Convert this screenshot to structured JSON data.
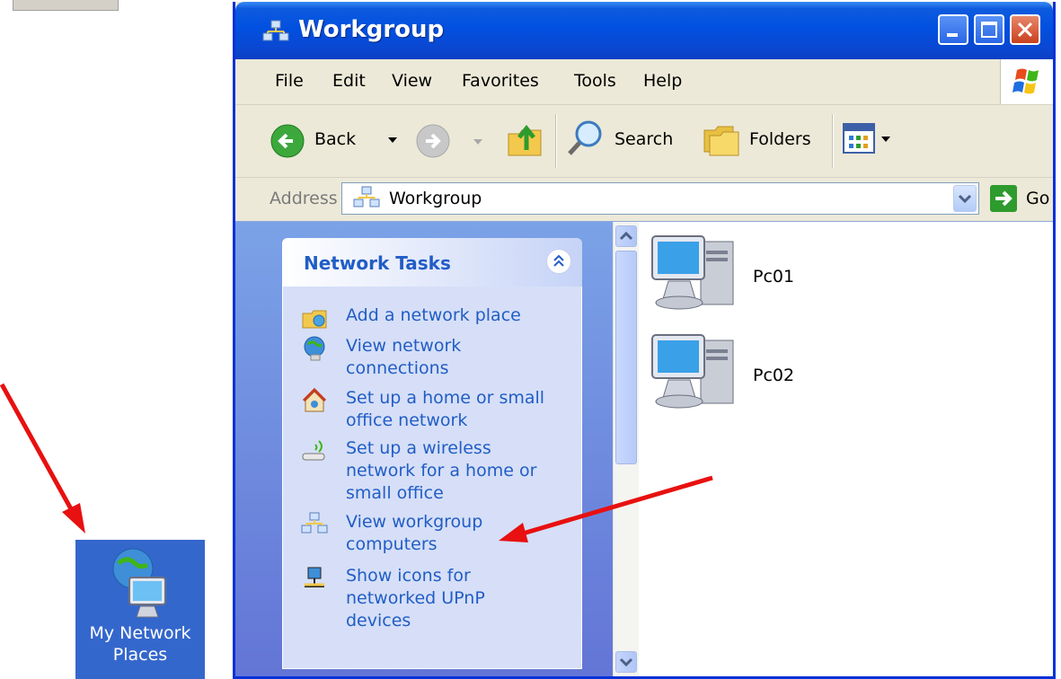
{
  "window": {
    "title": "Workgroup",
    "controls": [
      "minimize",
      "maximize",
      "close"
    ]
  },
  "menu": {
    "items": [
      "File",
      "Edit",
      "View",
      "Favorites",
      "Tools",
      "Help"
    ]
  },
  "toolbar": {
    "back_label": "Back",
    "search_label": "Search",
    "folders_label": "Folders"
  },
  "address": {
    "label": "Address",
    "value": "Workgroup",
    "go_label": "Go"
  },
  "tasks": {
    "title": "Network Tasks",
    "items": [
      {
        "label": "Add a network place",
        "icon": "add-network-place-icon"
      },
      {
        "label": "View network\nconnections",
        "icon": "network-connections-icon"
      },
      {
        "label": "Set up a home or small\noffice network",
        "icon": "home-network-icon"
      },
      {
        "label": "Set up a wireless\nnetwork for a home or\nsmall office",
        "icon": "wireless-network-icon"
      },
      {
        "label": "View workgroup\ncomputers",
        "icon": "workgroup-icon"
      },
      {
        "label": "Show icons for\nnetworked UPnP\ndevices",
        "icon": "upnp-icon"
      }
    ]
  },
  "files": [
    {
      "label": "Pc01",
      "icon": "computer-icon"
    },
    {
      "label": "Pc02",
      "icon": "computer-icon"
    }
  ],
  "desktop": {
    "icon_label": "My Network\nPlaces"
  },
  "colors": {
    "title_blue": "#0150e0",
    "task_link": "#215dc6",
    "arrow": "#e81010"
  }
}
